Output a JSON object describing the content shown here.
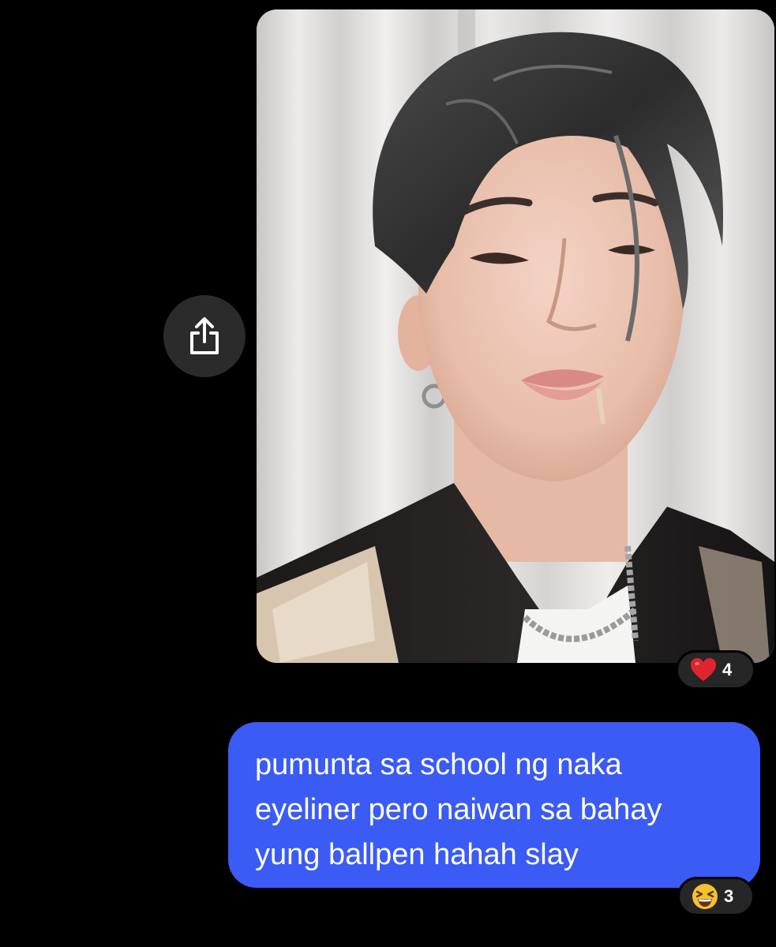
{
  "conversation": {
    "photo_message": {
      "image": "selfie-photo",
      "reaction": {
        "emoji": "red-heart",
        "count": "4"
      }
    },
    "share_button": {
      "icon": "share-icon"
    },
    "text_message": {
      "lines": [
        "pumunta sa school ng naka",
        "eyeliner pero naiwan sa bahay",
        "yung ballpen hahah slay"
      ],
      "reaction": {
        "emoji": "laughing-face",
        "count": "3"
      }
    }
  },
  "colors": {
    "background": "#000000",
    "bubble": "#3b5bf5",
    "reaction_pill": "#262626",
    "share_button": "#2b2b2b"
  }
}
